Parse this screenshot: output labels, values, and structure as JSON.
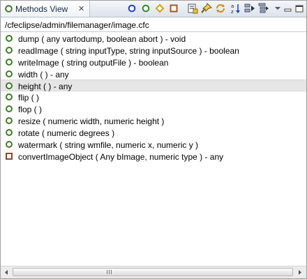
{
  "view": {
    "title": "Methods View",
    "close_glyph": "✕",
    "tab_icon": "methods-view-icon"
  },
  "toolbar": {
    "buttons": [
      {
        "name": "show-public-filter-button",
        "icon": "blue-circle-icon"
      },
      {
        "name": "show-package-filter-button",
        "icon": "green-circle-icon"
      },
      {
        "name": "show-remote-filter-button",
        "icon": "yellow-diamond-icon"
      },
      {
        "name": "show-private-filter-button",
        "icon": "orange-square-icon"
      },
      {
        "name": "insert-method-button",
        "icon": "insert-icon"
      },
      {
        "name": "pin-button",
        "icon": "pin-icon"
      },
      {
        "name": "refresh-button",
        "icon": "refresh-icon"
      },
      {
        "name": "sort-button",
        "icon": "sort-az-icon"
      },
      {
        "name": "collapse-button",
        "icon": "collapse-icon"
      },
      {
        "name": "expand-button",
        "icon": "expand-icon"
      },
      {
        "name": "view-menu-button",
        "icon": "chevron-down-icon"
      },
      {
        "name": "minimize-button",
        "icon": "minimize-icon"
      },
      {
        "name": "maximize-button",
        "icon": "maximize-icon"
      }
    ]
  },
  "file_path": "/cfeclipse/admin/filemanager/image.cfc",
  "methods": [
    {
      "label": "dump ( any vartodump, boolean abort ) - void",
      "access": "public"
    },
    {
      "label": "readImage ( string inputType, string inputSource ) - boolean",
      "access": "public"
    },
    {
      "label": "writeImage ( string outputFile ) - boolean",
      "access": "public"
    },
    {
      "label": "width ( ) - any",
      "access": "public"
    },
    {
      "label": "height ( ) - any",
      "access": "public",
      "selected": true
    },
    {
      "label": "flip ( )",
      "access": "public"
    },
    {
      "label": "flop ( )",
      "access": "public"
    },
    {
      "label": "resize ( numeric width, numeric height )",
      "access": "public"
    },
    {
      "label": "rotate ( numeric degrees )",
      "access": "public"
    },
    {
      "label": "watermark ( string wmfile, numeric x, numeric y )",
      "access": "public"
    },
    {
      "label": "convertImageObject ( Any bImage, numeric type ) - any",
      "access": "private"
    }
  ],
  "scrollbar": {
    "left_icon": "scroll-left-icon",
    "right_icon": "scroll-right-icon"
  }
}
